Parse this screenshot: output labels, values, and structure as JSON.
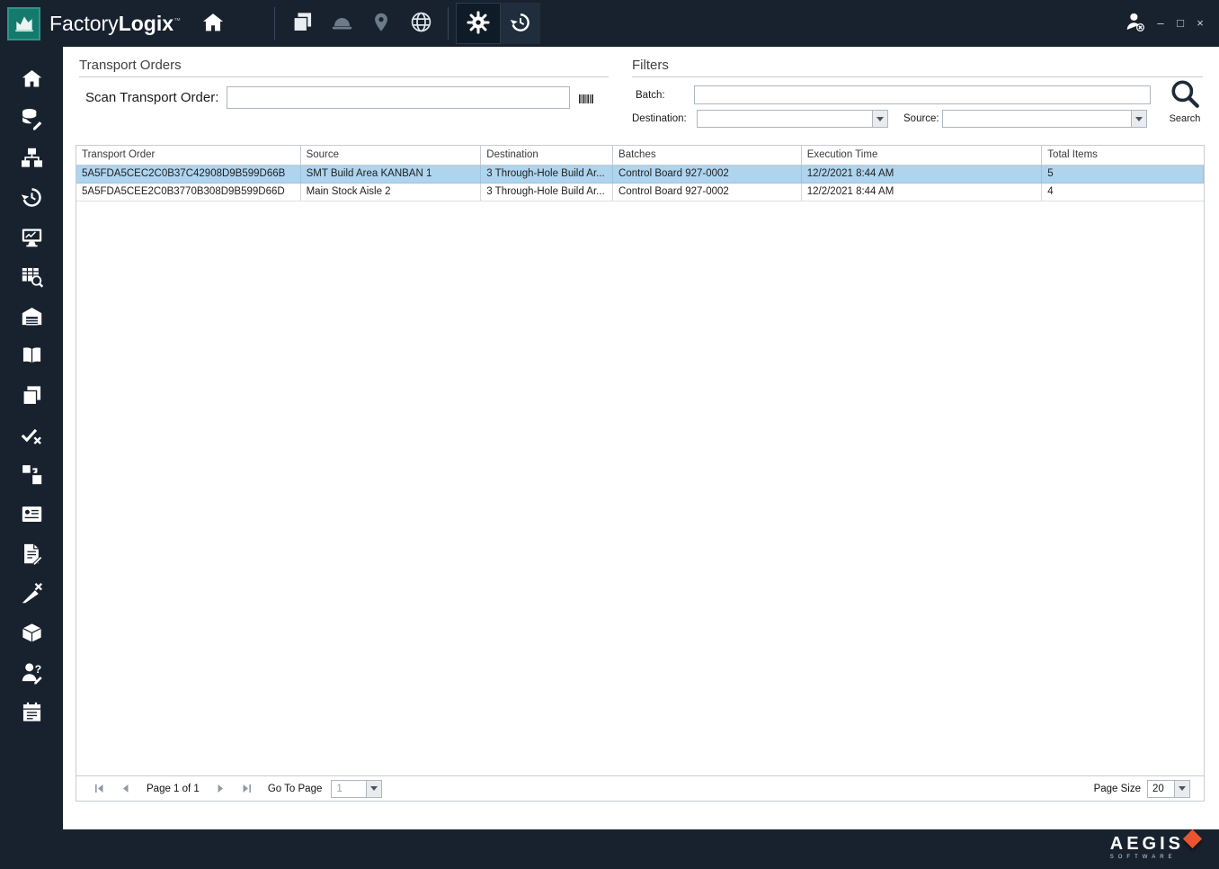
{
  "titlebar": {
    "brand_factory": "Factory",
    "brand_logix": "Logix",
    "brand_tm": "™",
    "minimize": "–",
    "maximize": "□",
    "close": "×",
    "toolbar_icons": [
      "documents",
      "hardhat",
      "location-pin",
      "globe",
      "settings-gear",
      "history"
    ]
  },
  "sidebar": {
    "icons": [
      "home",
      "data-edit",
      "workflow",
      "history",
      "monitor",
      "table-search",
      "warehouse",
      "book",
      "copy",
      "task-check",
      "transfer",
      "form-card",
      "document-edit",
      "design-check",
      "package-out",
      "user-question",
      "report-calendar"
    ]
  },
  "content": {
    "transport_orders_title": "Transport Orders",
    "scan_label": "Scan Transport Order:",
    "scan_value": "",
    "filters_title": "Filters",
    "batch_label": "Batch:",
    "batch_value": "",
    "destination_label": "Destination:",
    "destination_value": "",
    "source_label": "Source:",
    "source_value": "",
    "search_label": "Search"
  },
  "table": {
    "columns": [
      "Transport Order",
      "Source",
      "Destination",
      "Batches",
      "Execution Time",
      "Total Items"
    ],
    "rows": [
      {
        "transport_order": "5A5FDA5CEC2C0B37C42908D9B599D66B",
        "source": "SMT Build Area KANBAN 1",
        "destination": "3 Through-Hole Build Ar...",
        "batches": "Control Board 927-0002",
        "execution_time": "12/2/2021 8:44 AM",
        "total_items": "5"
      },
      {
        "transport_order": "5A5FDA5CEE2C0B3770B308D9B599D66D",
        "source": "Main Stock Aisle 2",
        "destination": "3 Through-Hole Build Ar...",
        "batches": "Control Board 927-0002",
        "execution_time": "12/2/2021 8:44 AM",
        "total_items": "4"
      }
    ]
  },
  "pagination": {
    "page_text": "Page 1 of 1",
    "go_to_page_label": "Go To Page",
    "go_to_page_value": "1",
    "page_size_label": "Page Size",
    "page_size_value": "20"
  },
  "footer": {
    "brand": "AEGIS",
    "brand_sub": "SOFTWARE"
  },
  "colors": {
    "navy": "#18222f",
    "teal": "#157a6e",
    "selected_row": "#aed4ee",
    "accent_orange": "#e8552e"
  }
}
